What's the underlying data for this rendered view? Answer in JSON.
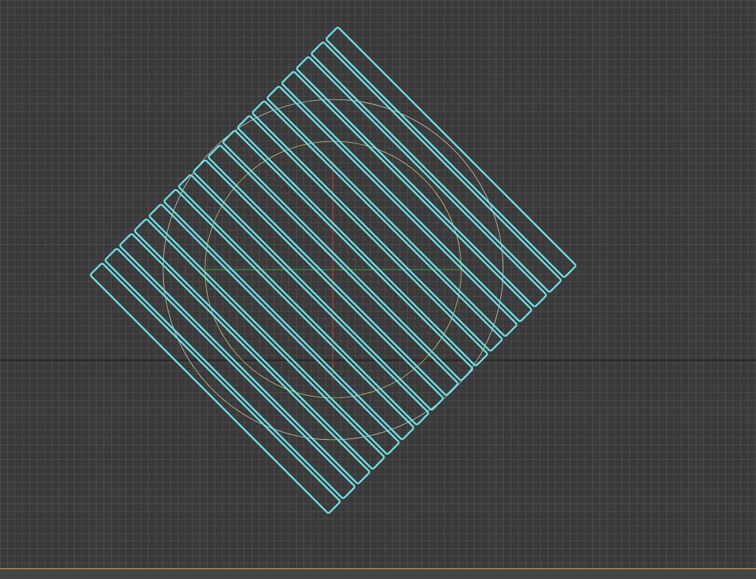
{
  "viewport": {
    "background": "#3a3a3a",
    "grid_color": "#5c5c5c",
    "major_grid_color": "#222222",
    "selection_color": "#6fe0e6",
    "outer_circle_color": "#d8d8c8",
    "inner_circle_color": "#d6d27a",
    "x_axis_color": "#3fa83f",
    "y_axis_color": "#c23a3a",
    "plank_count": 17
  }
}
